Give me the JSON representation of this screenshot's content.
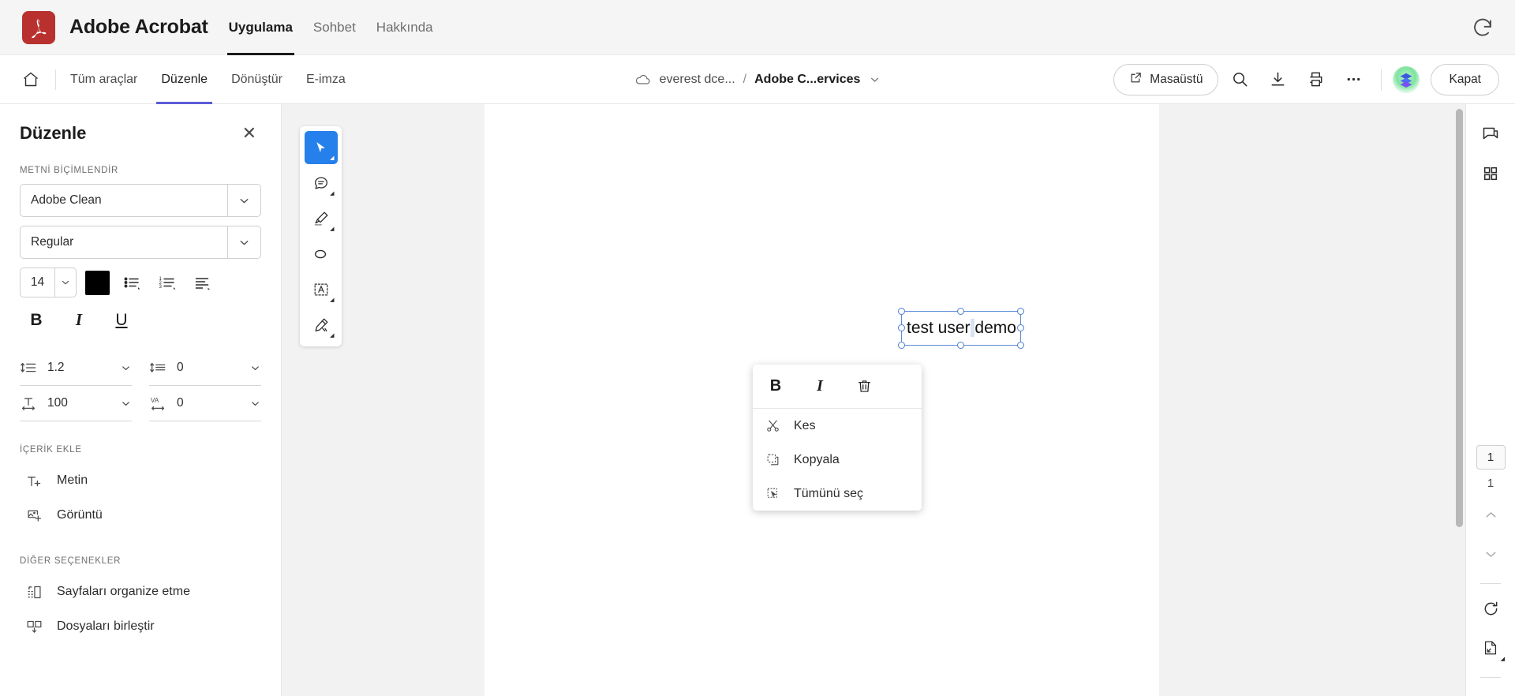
{
  "brand": {
    "logo_icon": "adobe-acrobat-logo",
    "logo_glyph": "A",
    "name": "Adobe Acrobat",
    "tabs": [
      {
        "label": "Uygulama",
        "active": true
      },
      {
        "label": "Sohbet",
        "active": false
      },
      {
        "label": "Hakkında",
        "active": false
      }
    ],
    "refresh_icon": "refresh-icon"
  },
  "nav": {
    "home_icon": "home-icon",
    "tabs": [
      {
        "label": "Tüm araçlar",
        "active": false
      },
      {
        "label": "Düzenle",
        "active": true
      },
      {
        "label": "Dönüştür",
        "active": false
      },
      {
        "label": "E-imza",
        "active": false
      }
    ],
    "breadcrumb": {
      "cloud_icon": "cloud-icon",
      "owner": "everest dce...",
      "separator": "/",
      "document": "Adobe C...ervices",
      "chevron_icon": "chevron-down-icon"
    },
    "desktop_button": {
      "label": "Masaüstü",
      "icon": "external-link-icon"
    },
    "search_icon": "search-icon",
    "download_icon": "download-icon",
    "print_icon": "print-icon",
    "more_icon": "more-horizontal-icon",
    "avatar_icon": "user-avatar",
    "close_button": "Kapat"
  },
  "panel": {
    "title": "Düzenle",
    "close_icon": "close-icon",
    "format_section": "METNİ BİÇİMLENDİR",
    "font_family": "Adobe Clean",
    "font_style": "Regular",
    "font_size": "14",
    "text_color": "#000000",
    "list_icons": {
      "bullet": "bullet-list-icon",
      "numbered": "numbered-list-icon",
      "align": "text-align-icon"
    },
    "styles": {
      "bold": "B",
      "italic": "I",
      "underline": "U"
    },
    "spacing": [
      {
        "icon": "line-spacing-icon",
        "value": "1.2"
      },
      {
        "icon": "paragraph-spacing-icon",
        "value": "0"
      },
      {
        "icon": "horizontal-scale-icon",
        "value": "100"
      },
      {
        "icon": "letter-spacing-icon",
        "value": "0",
        "glyph": "VA"
      }
    ],
    "content_section": "İÇERİK EKLE",
    "content_items": [
      {
        "label": "Metin",
        "icon": "add-text-icon"
      },
      {
        "label": "Görüntü",
        "icon": "add-image-icon"
      }
    ],
    "other_section": "DİĞER SEÇENEKLER",
    "other_items": [
      {
        "label": "Sayfaları organize etme",
        "icon": "organize-pages-icon"
      },
      {
        "label": "Dosyaları birleştir",
        "icon": "combine-files-icon"
      }
    ]
  },
  "toolstrip": [
    {
      "icon": "select-cursor-icon",
      "active": true
    },
    {
      "icon": "comment-icon",
      "active": false
    },
    {
      "icon": "highlighter-icon",
      "active": false
    },
    {
      "icon": "lasso-icon",
      "active": false
    },
    {
      "icon": "text-box-icon",
      "active": false
    },
    {
      "icon": "signature-pen-icon",
      "active": false
    }
  ],
  "document": {
    "selected_text": "test user demo",
    "selection_color": "#4a7fd4"
  },
  "context_menu": {
    "top_actions": [
      {
        "label": "B",
        "icon": "bold-icon"
      },
      {
        "label": "I",
        "icon": "italic-icon"
      },
      {
        "label": "",
        "icon": "trash-icon"
      }
    ],
    "items": [
      {
        "label": "Kes",
        "icon": "scissors-icon"
      },
      {
        "label": "Kopyala",
        "icon": "copy-icon"
      },
      {
        "label": "Tümünü seç",
        "icon": "select-all-icon"
      }
    ]
  },
  "rail": {
    "top_icons": [
      {
        "icon": "comment-panel-icon"
      },
      {
        "icon": "grid-thumbnails-icon"
      }
    ],
    "page_current": "1",
    "page_total": "1",
    "prev_icon": "chevron-up-icon",
    "next_icon": "chevron-down-icon",
    "rotate_icon": "rotate-icon",
    "fit-page_icon": "fit-page-icon"
  },
  "colors": {
    "accent": "#5b5bd6",
    "tool_active": "#2680eb",
    "brand_red": "#b8312f"
  }
}
